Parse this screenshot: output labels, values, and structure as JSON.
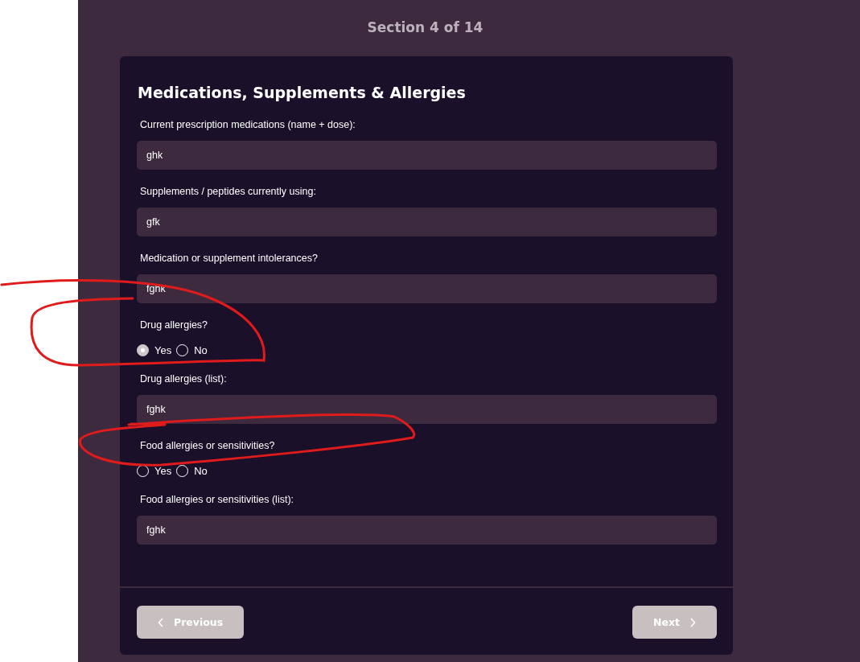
{
  "progress": "Section 4 of 14",
  "form": {
    "title": "Medications, Supplements & Allergies",
    "items": [
      {
        "kind": "text",
        "label": "Current prescription medications (name + dose):",
        "value": "ghk"
      },
      {
        "kind": "text",
        "label": "Supplements / peptides currently using:",
        "value": "gfk"
      },
      {
        "kind": "text",
        "label": "Medication or supplement intolerances?",
        "value": "fghk"
      },
      {
        "kind": "radio",
        "label": "Drug allergies?",
        "options": [
          {
            "label": "Yes",
            "selected": true
          },
          {
            "label": "No",
            "selected": false
          }
        ]
      },
      {
        "kind": "text",
        "label": "Drug allergies (list):",
        "value": "fghk"
      },
      {
        "kind": "radio",
        "label": "Food allergies or sensitivities?",
        "options": [
          {
            "label": "Yes",
            "selected": false
          },
          {
            "label": "No",
            "selected": false
          }
        ]
      },
      {
        "kind": "text",
        "label": "Food allergies or sensitivities (list):",
        "value": "fghk"
      }
    ]
  },
  "buttons": {
    "previous": "Previous",
    "next": "Next"
  }
}
